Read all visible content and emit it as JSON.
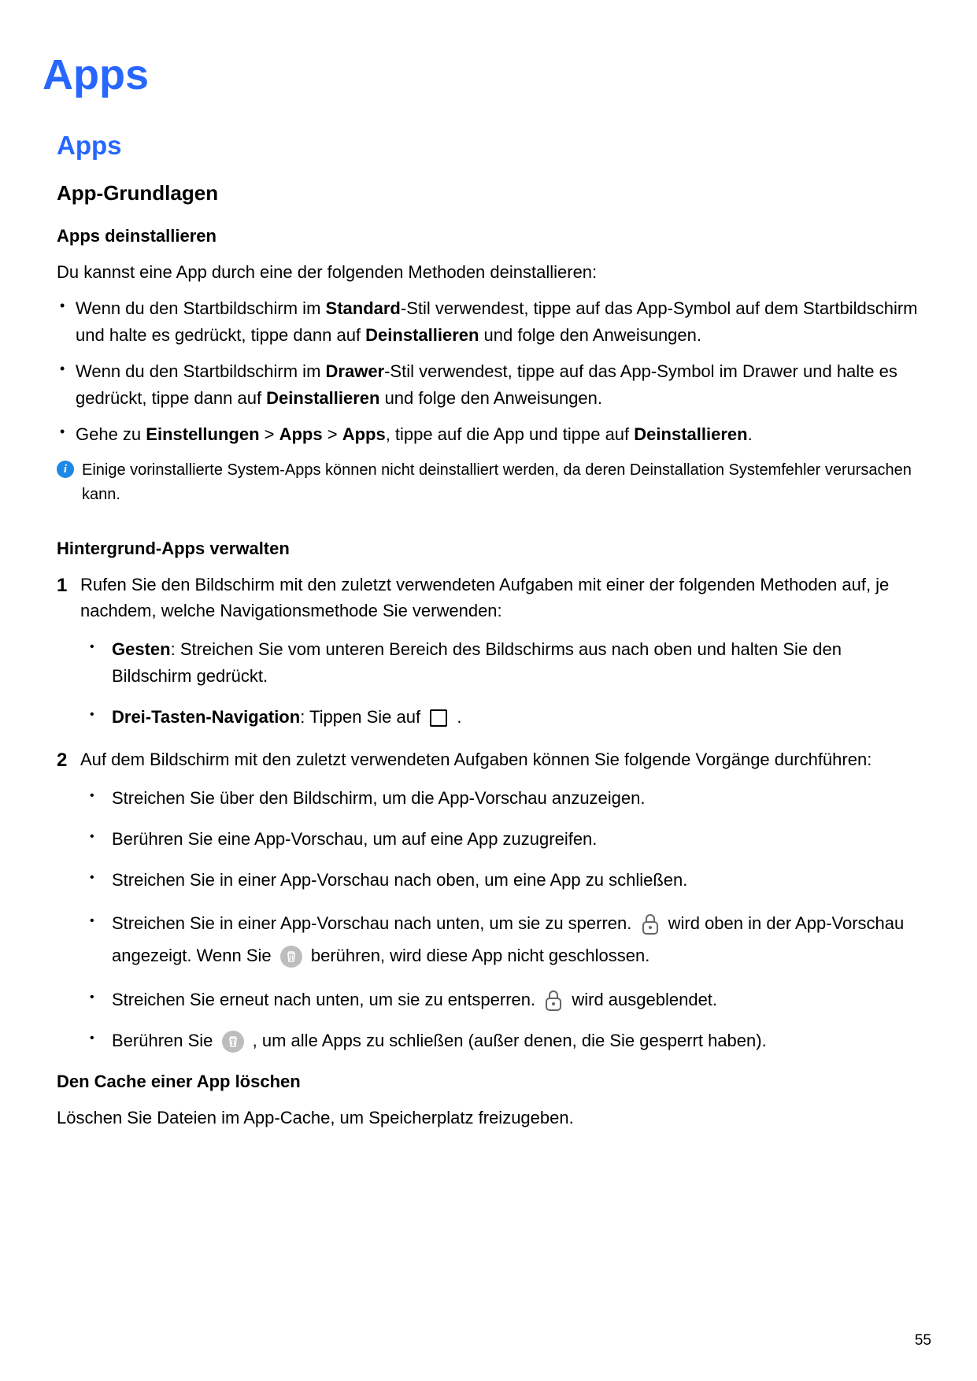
{
  "h1": "Apps",
  "h2": "Apps",
  "h3_basics": "App-Grundlagen",
  "uninstall": {
    "heading": "Apps deinstallieren",
    "intro": "Du kannst eine App durch eine der folgenden Methoden deinstallieren:",
    "b1_a": "Wenn du den Startbildschirm im ",
    "b1_bold1": "Standard",
    "b1_b": "-Stil verwendest, tippe auf das App-Symbol auf dem Startbildschirm und halte es gedrückt, tippe dann auf ",
    "b1_bold2": "Deinstallieren",
    "b1_c": " und folge den Anweisungen.",
    "b2_a": "Wenn du den Startbildschirm im ",
    "b2_bold1": "Drawer",
    "b2_b": "-Stil verwendest, tippe auf das App-Symbol im Drawer und halte es gedrückt, tippe dann auf ",
    "b2_bold2": "Deinstallieren",
    "b2_c": " und folge den Anweisungen.",
    "b3_a": "Gehe zu ",
    "b3_bold1": "Einstellungen",
    "b3_gt": " > ",
    "b3_bold2": "Apps",
    "b3_bold3": "Apps",
    "b3_b": ", tippe auf die App und tippe auf ",
    "b3_bold4": "Deinstallieren",
    "b3_c": ".",
    "note": "Einige vorinstallierte System-Apps können nicht deinstalliert werden, da deren Deinstallation Systemfehler verursachen kann."
  },
  "bg": {
    "heading": "Hintergrund-Apps verwalten",
    "s1": "Rufen Sie den Bildschirm mit den zuletzt verwendeten Aufgaben mit einer der folgenden Methoden auf, je nachdem, welche Navigationsmethode Sie verwenden:",
    "s1_sub1_bold": "Gesten",
    "s1_sub1_rest": ": Streichen Sie vom unteren Bereich des Bildschirms aus nach oben und halten Sie den Bildschirm gedrückt.",
    "s1_sub2_bold": "Drei-Tasten-Navigation",
    "s1_sub2_rest_a": ": Tippen Sie auf ",
    "s1_sub2_rest_b": " .",
    "s2": "Auf dem Bildschirm mit den zuletzt verwendeten Aufgaben können Sie folgende Vorgänge durchführen:",
    "s2_sub1": "Streichen Sie über den Bildschirm, um die App-Vorschau anzuzeigen.",
    "s2_sub2": "Berühren Sie eine App-Vorschau, um auf eine App zuzugreifen.",
    "s2_sub3": "Streichen Sie in einer App-Vorschau nach oben, um eine App zu schließen.",
    "s2_sub4_a": "Streichen Sie in einer App-Vorschau nach unten, um sie zu sperren. ",
    "s2_sub4_b": " wird oben in der App-Vorschau angezeigt. Wenn Sie ",
    "s2_sub4_c": " berühren, wird diese App nicht geschlossen.",
    "s2_sub5_a": "Streichen Sie erneut nach unten, um sie zu entsperren. ",
    "s2_sub5_b": " wird ausgeblendet.",
    "s2_sub6_a": "Berühren Sie ",
    "s2_sub6_b": " , um alle Apps zu schließen (außer denen, die Sie gesperrt haben)."
  },
  "cache": {
    "heading": "Den Cache einer App löschen",
    "text": "Löschen Sie Dateien im App-Cache, um Speicherplatz freizugeben."
  },
  "page_number": "55",
  "icons": {
    "info": "info-icon",
    "square": "recent-apps-square-icon",
    "lock": "lock-icon",
    "trash": "trash-icon"
  }
}
